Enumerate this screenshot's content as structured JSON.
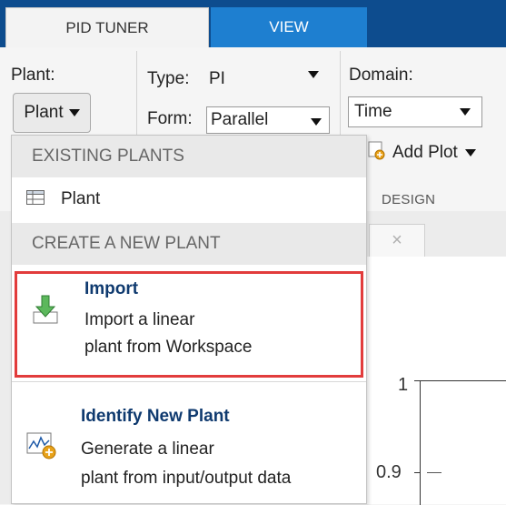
{
  "tabs": [
    {
      "label": "PID TUNER",
      "active": true
    },
    {
      "label": "VIEW",
      "active": false
    }
  ],
  "toolstrip": {
    "plant_label": "Plant:",
    "plant_button": "Plant",
    "type_label": "Type:",
    "type_value": "PI",
    "form_label": "Form:",
    "form_value": "Parallel",
    "domain_label": "Domain:",
    "domain_value": "Time",
    "add_plot_label": "Add Plot",
    "design_section": "DESIGN"
  },
  "plot": {
    "y_ticks": [
      "1",
      "0.9"
    ],
    "doc_tab_close": "×"
  },
  "menu": {
    "existing_header": "EXISTING PLANTS",
    "existing_items": [
      {
        "label": "Plant",
        "icon": "table-icon"
      }
    ],
    "create_header": "CREATE A NEW PLANT",
    "import": {
      "title": "Import",
      "desc_line1": "Import a linear",
      "desc_line2": "plant from Workspace",
      "icon": "import-arrow-icon",
      "highlighted": true
    },
    "identify": {
      "title": "Identify New Plant",
      "desc_line1": "Generate a linear",
      "desc_line2": "plant from input/output data",
      "icon": "identify-plant-icon"
    }
  },
  "colors": {
    "tab_bar": "#0d4c8e",
    "view_tab": "#1e7fd0",
    "highlight_border": "#e23c3c",
    "title_text": "#0f3a6f"
  }
}
